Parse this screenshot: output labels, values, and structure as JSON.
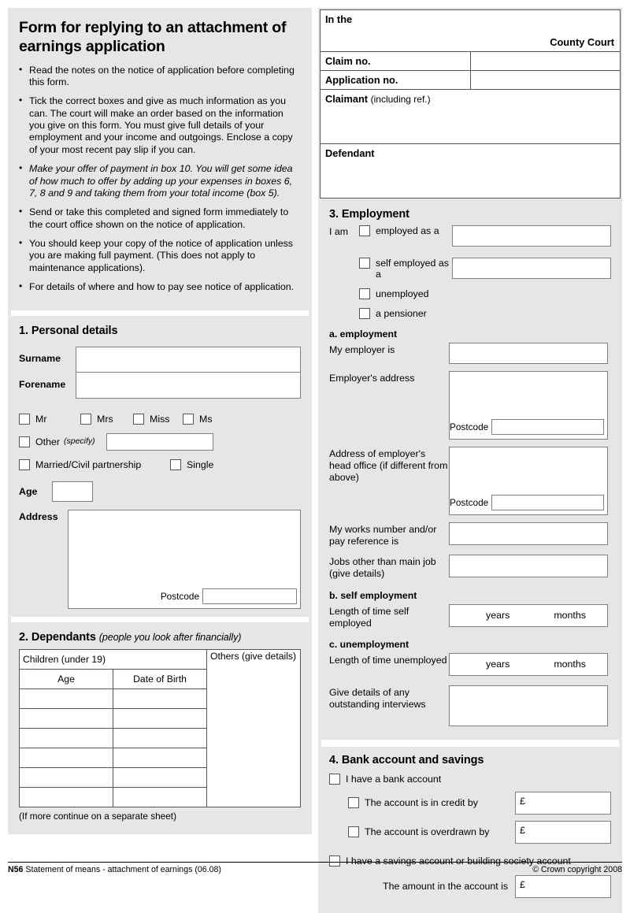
{
  "intro": {
    "title": "Form for replying to an attachment of earnings application",
    "bullets": [
      {
        "text": "Read the notes on the notice of application before completing this form.",
        "italic": false
      },
      {
        "text": "Tick the correct boxes and give as much information as you can. The court will make an order based on the information you give on this form. You must give full details of your employment and your income and outgoings. Enclose a copy of your most recent pay slip if you can.",
        "italic": false
      },
      {
        "text": "Make your offer of payment in box 10. You will get some idea of how much to offer by adding up your expenses in boxes 6, 7, 8 and 9 and taking them from your total income (box 5).",
        "italic": true
      },
      {
        "text": "Send or take this completed and signed form immediately to the court office shown on the notice of application.",
        "italic": false
      },
      {
        "text": "You should keep your copy of the notice of application unless you are making full payment. (This does not apply to maintenance applications).",
        "italic": false
      },
      {
        "text": "For details of where and how to pay see notice of application.",
        "italic": false
      }
    ]
  },
  "court": {
    "in_the": "In the",
    "county_court": "County Court",
    "claim_no_label": "Claim no.",
    "claim_no_value": "",
    "application_no_label": "Application no.",
    "application_no_value": "",
    "claimant_label": "Claimant",
    "claimant_label_suffix": "(including ref.)",
    "claimant_value": "",
    "defendant_label": "Defendant",
    "defendant_value": ""
  },
  "section1": {
    "heading": "1. Personal details",
    "surname_label": "Surname",
    "surname_value": "",
    "forename_label": "Forename",
    "forename_value": "",
    "titles": [
      "Mr",
      "Mrs",
      "Miss",
      "Ms"
    ],
    "other_label": "Other",
    "other_hint": "(specify)",
    "other_value": "",
    "marital": [
      "Married/Civil partnership",
      "Single"
    ],
    "age_label": "Age",
    "age_value": "",
    "address_label": "Address",
    "address_value": "",
    "postcode_label": "Postcode",
    "postcode_value": ""
  },
  "section2": {
    "heading": "2. Dependants",
    "heading_sub": "(people you look after financially)",
    "children_header": "Children (under 19)",
    "others_header": "Others (give details)",
    "col_age": "Age",
    "col_dob": "Date of Birth",
    "rows": [
      {
        "age": "",
        "dob": ""
      },
      {
        "age": "",
        "dob": ""
      },
      {
        "age": "",
        "dob": ""
      },
      {
        "age": "",
        "dob": ""
      },
      {
        "age": "",
        "dob": ""
      },
      {
        "age": "",
        "dob": ""
      }
    ],
    "others_value": "",
    "note": "(If more continue on a separate sheet)"
  },
  "section3": {
    "heading": "3. Employment",
    "i_am_label": "I am",
    "employed_label": "employed as a",
    "employed_value": "",
    "self_employed_label": "self employed as a",
    "self_employed_value": "",
    "unemployed_label": "unemployed",
    "pensioner_label": "a pensioner",
    "sub_a": "a. employment",
    "employer_label": "My employer is",
    "employer_value": "",
    "employer_address_label": "Employer's address",
    "employer_address_value": "",
    "postcode_label": "Postcode",
    "employer_postcode_value": "",
    "head_office_label": "Address of employer's head office",
    "head_office_label_ital": "(if different from above)",
    "head_office_value": "",
    "head_office_postcode_value": "",
    "works_number_label": "My works number and/or pay reference is",
    "works_number_value": "",
    "other_jobs_label": "Jobs other than main job",
    "other_jobs_label_ital": "(give details)",
    "other_jobs_value": "",
    "sub_b": "b. self employment",
    "self_length_label": "Length of time self employed",
    "years_label": "years",
    "months_label": "months",
    "self_years_value": "",
    "self_months_value": "",
    "sub_c": "c. unemployment",
    "unemp_length_label": "Length of time unemployed",
    "unemp_years_value": "",
    "unemp_months_value": "",
    "interviews_label": "Give details of any outstanding interviews",
    "interviews_value": ""
  },
  "section4": {
    "heading": "4. Bank account and savings",
    "has_bank_label": "I have a bank account",
    "credit_label": "The account is in credit by",
    "credit_currency": "£",
    "credit_value": "",
    "overdrawn_label": "The account is overdrawn by",
    "overdrawn_currency": "£",
    "overdrawn_value": "",
    "has_savings_label": "I have a savings account or building society account",
    "savings_amount_label": "The amount in the account is",
    "savings_currency": "£",
    "savings_value": ""
  },
  "footer": {
    "code": "N56",
    "description": "Statement of means - attachment of earnings (06.08)",
    "copyright": "© Crown copyright 2008"
  }
}
